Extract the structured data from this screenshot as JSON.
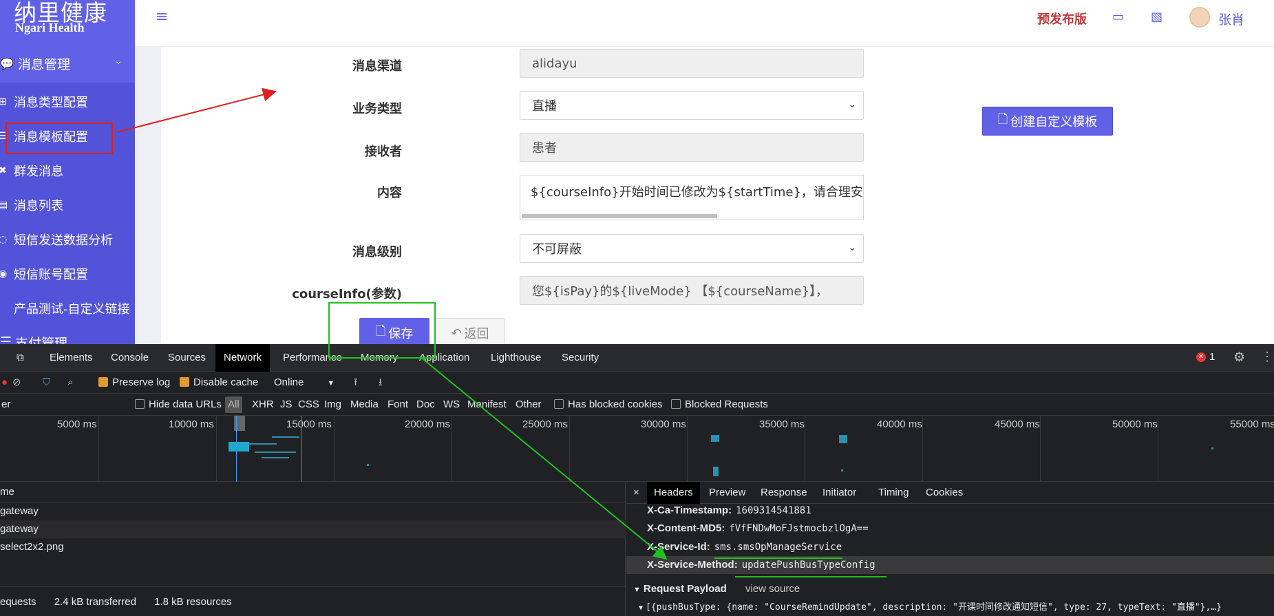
{
  "app": {
    "logo_cn": "纳里健康",
    "logo_en": "Ngari Health",
    "env_label": "预发布版",
    "user_name": "张肖",
    "accent_color": "#6161e8"
  },
  "sidebar": {
    "section_label": "消息管理",
    "items": [
      {
        "label": "消息类型配置",
        "icon": "plus-square-icon"
      },
      {
        "label": "消息模板配置",
        "icon": "list-icon"
      },
      {
        "label": "群发消息",
        "icon": "cross-icon"
      },
      {
        "label": "消息列表",
        "icon": "list-icon"
      },
      {
        "label": "短信发送数据分析",
        "icon": "chat-icon"
      },
      {
        "label": "短信账号配置",
        "icon": "account-icon"
      },
      {
        "label": "产品测试-自定义链接",
        "icon": ""
      }
    ],
    "section2_label": "支付管理"
  },
  "form": {
    "channel_label": "消息渠道",
    "channel_value": "alidayu",
    "biz_type_label": "业务类型",
    "biz_type_value": "直播",
    "receiver_label": "接收者",
    "receiver_value": "患者",
    "content_label": "内容",
    "content_value": "${courseInfo}开始时间已修改为${startTime}，请合理安排时间，",
    "level_label": "消息级别",
    "level_value": "不可屏蔽",
    "param_label": "courseInfo(参数)",
    "param_value": "您${isPay}的${liveMode} 【${courseName}】，",
    "create_button": "创建自定义模板",
    "save_button": "保存",
    "back_button": "返回"
  },
  "devtools": {
    "tabs": [
      "Elements",
      "Console",
      "Sources",
      "Network",
      "Performance",
      "Memory",
      "Application",
      "Lighthouse",
      "Security"
    ],
    "active_tab": "Network",
    "error_count": "1",
    "toolbar": {
      "preserve_log": "Preserve log",
      "disable_cache": "Disable cache",
      "throttle": "Online"
    },
    "filter": {
      "placeholder": "er",
      "hide_data_urls": "Hide data URLs",
      "types": [
        "All",
        "XHR",
        "JS",
        "CSS",
        "Img",
        "Media",
        "Font",
        "Doc",
        "WS",
        "Manifest",
        "Other"
      ],
      "blocked_cookies": "Has blocked cookies",
      "blocked_requests": "Blocked Requests"
    },
    "timeline_ticks": [
      "5000 ms",
      "10000 ms",
      "15000 ms",
      "20000 ms",
      "25000 ms",
      "30000 ms",
      "35000 ms",
      "40000 ms",
      "45000 ms",
      "50000 ms",
      "55000 ms"
    ],
    "request_header": "me",
    "requests": [
      "gateway",
      "gateway",
      "select2x2.png"
    ],
    "summary": {
      "requests": "equests",
      "transferred": "2.4 kB transferred",
      "resources": "1.8 kB resources"
    },
    "detail_tabs": [
      "Headers",
      "Preview",
      "Response",
      "Initiator",
      "Timing",
      "Cookies"
    ],
    "headers": [
      {
        "key": "X-Ca-Timestamp:",
        "value": "1609314541881"
      },
      {
        "key": "X-Content-MD5:",
        "value": "fVfFNDwMoFJstmocbzlOgA=="
      },
      {
        "key": "X-Service-Id:",
        "value": "sms.smsOpManageService"
      },
      {
        "key": "X-Service-Method:",
        "value": "updatePushBusTypeConfig"
      }
    ],
    "payload_title": "Request Payload",
    "view_source": "view source",
    "payload_line": "[{pushBusType: {name: \"CourseRemindUpdate\", description: \"开课时间修改通知短信\", type: 27, typeText: \"直播\"},…}"
  }
}
